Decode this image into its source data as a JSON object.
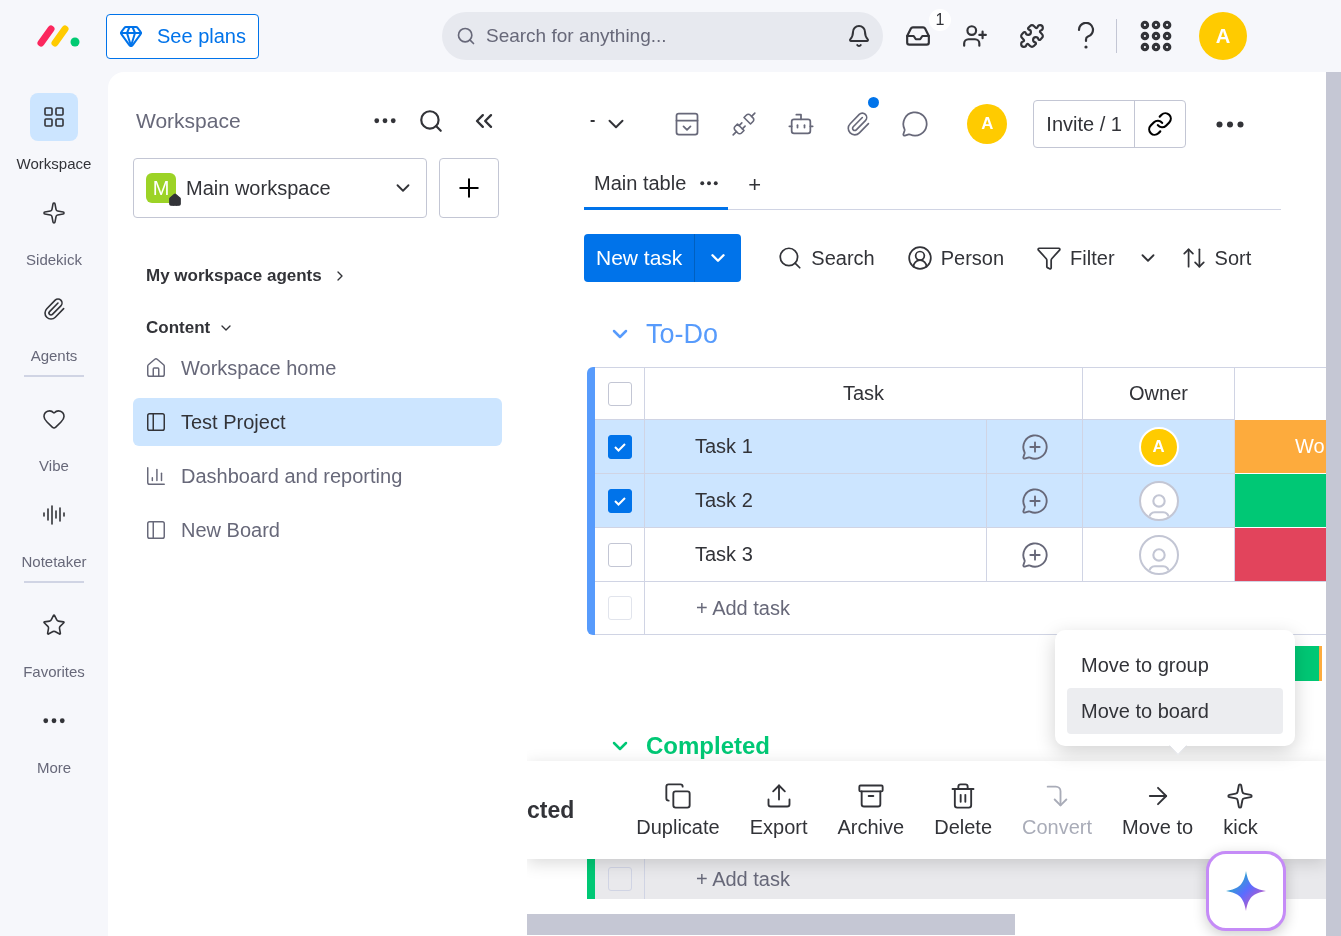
{
  "topbar": {
    "plans_button": "See plans",
    "search": {
      "placeholder": "Search for anything..."
    },
    "inbox_badge": "1",
    "avatar": "A"
  },
  "rail": {
    "groups": [
      [
        {
          "label": "Workspace",
          "selected": true
        },
        {
          "label": "Sidekick",
          "selected": false
        },
        {
          "label": "Agents",
          "selected": false
        }
      ],
      [
        {
          "label": "Vibe",
          "selected": false
        },
        {
          "label": "Notetaker",
          "selected": false
        }
      ],
      [
        {
          "label": "Favorites",
          "selected": false
        },
        {
          "label": "More",
          "selected": false
        }
      ]
    ]
  },
  "sidebar": {
    "title": "Workspace",
    "workspace": {
      "name": "Main workspace",
      "initial": "M"
    },
    "agents_link": "My workspace agents",
    "section": "Content",
    "items": [
      {
        "label": "Workspace home",
        "selected": false
      },
      {
        "label": "Test Project",
        "selected": true
      },
      {
        "label": "Dashboard and reporting",
        "selected": false
      },
      {
        "label": "New Board",
        "selected": false
      }
    ]
  },
  "board": {
    "title": "-",
    "avatar": "A",
    "invite": "Invite / 1",
    "has_notification": true,
    "tabs": [
      {
        "label": "Main table",
        "selected": true
      }
    ],
    "add_tab": "+",
    "new_task": "New task",
    "tools": [
      {
        "label": "Search",
        "dropdown": false
      },
      {
        "label": "Person",
        "dropdown": false
      },
      {
        "label": "Filter",
        "dropdown": true
      },
      {
        "label": "Sort",
        "dropdown": false
      }
    ],
    "groups": [
      {
        "title": "To-Do",
        "color": "#579bfc",
        "columns": [
          "Task",
          "Owner"
        ],
        "header_checked": false,
        "rows": [
          {
            "name": "Task 1",
            "checked": true,
            "owner": {
              "kind": "avatar",
              "initial": "A"
            },
            "status": {
              "color": "#fdab3d",
              "text": "Wo"
            }
          },
          {
            "name": "Task 2",
            "checked": true,
            "owner": {
              "kind": "empty"
            },
            "status": {
              "color": "#00c875"
            }
          },
          {
            "name": "Task 3",
            "checked": false,
            "owner": {
              "kind": "empty"
            },
            "status": {
              "color": "#e2445c"
            }
          }
        ],
        "add_task": "+ Add task",
        "add_checked": false
      },
      {
        "title": "Completed",
        "color": "#00c875",
        "add_task": "+ Add task",
        "add_checked": false
      }
    ]
  },
  "action_bar": {
    "selected_text": "cted",
    "actions": [
      {
        "label": "Duplicate",
        "disabled": false
      },
      {
        "label": "Export",
        "disabled": false
      },
      {
        "label": "Archive",
        "disabled": false
      },
      {
        "label": "Delete",
        "disabled": false
      },
      {
        "label": "Convert",
        "disabled": true
      },
      {
        "label": "Move to",
        "disabled": false
      },
      {
        "label": "kick",
        "disabled": false
      }
    ]
  },
  "move_menu": {
    "items": [
      {
        "label": "Move to group",
        "selected": false
      },
      {
        "label": "Move to board",
        "selected": true
      }
    ]
  }
}
